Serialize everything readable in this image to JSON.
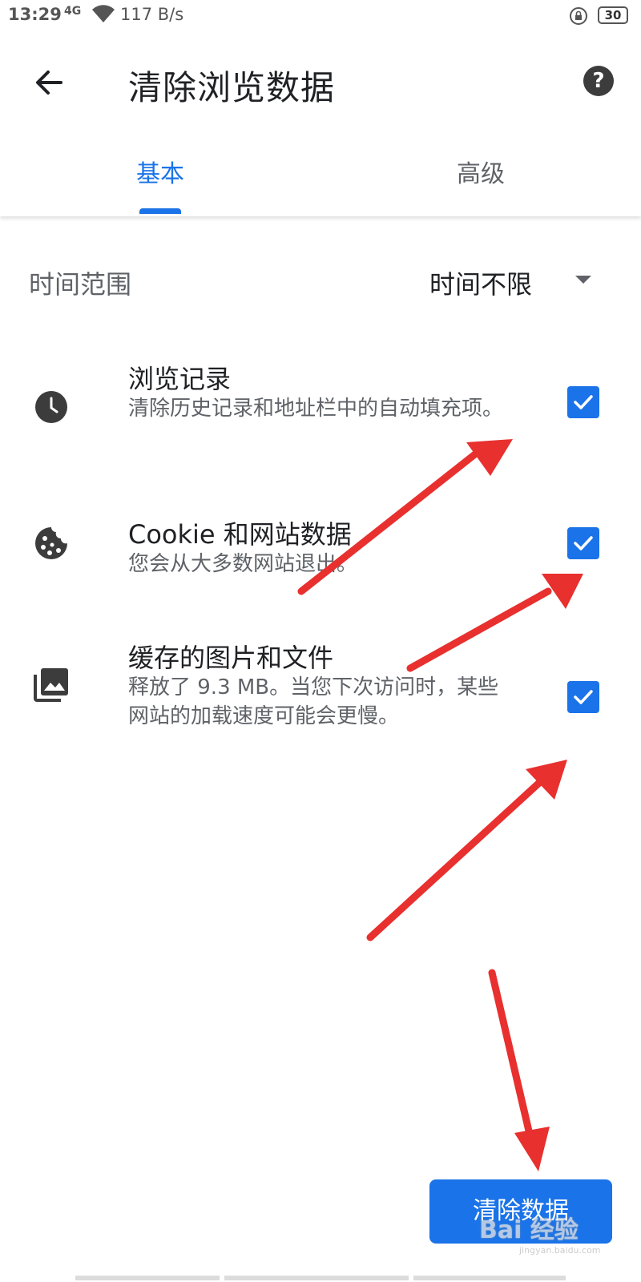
{
  "status_bar": {
    "time": "13:29",
    "network": "4G",
    "speed": "117 B/s",
    "battery": "30"
  },
  "header": {
    "title": "清除浏览数据",
    "back_icon": "arrow-back-icon",
    "help_icon": "help-icon",
    "help_glyph": "?"
  },
  "tabs": [
    {
      "label": "基本",
      "active": true
    },
    {
      "label": "高级",
      "active": false
    }
  ],
  "time_range": {
    "label": "时间范围",
    "value": "时间不限"
  },
  "options": [
    {
      "icon": "clock-icon",
      "title": "浏览记录",
      "description": "清除历史记录和地址栏中的自动填充项。",
      "checked": true
    },
    {
      "icon": "cookie-icon",
      "title": "Cookie 和网站数据",
      "description": "您会从大多数网站退出。",
      "checked": true
    },
    {
      "icon": "image-library-icon",
      "title": "缓存的图片和文件",
      "description": "释放了 9.3 MB。当您下次访问时，某些网站的加载速度可能会更慢。",
      "checked": true
    }
  ],
  "actions": {
    "clear_button": "清除数据"
  },
  "watermark": {
    "brand": "Bai 经验",
    "url": "jingyan.baidu.com"
  },
  "colors": {
    "accent": "#1a73e8",
    "annotation_arrow": "#e8302f"
  }
}
